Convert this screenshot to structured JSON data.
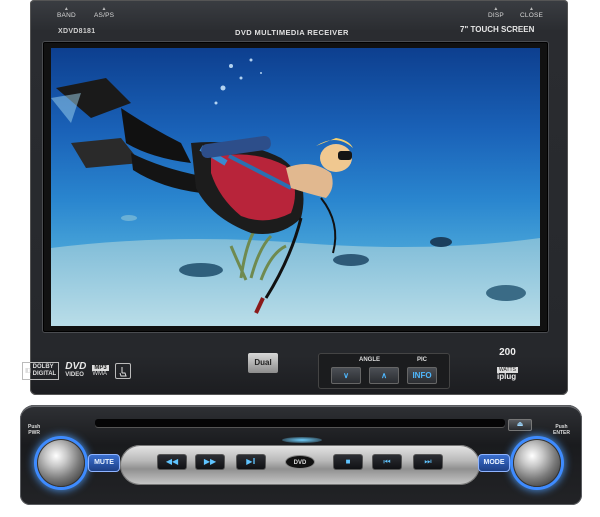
{
  "monitor": {
    "top_buttons": [
      {
        "label": "BAND"
      },
      {
        "label": "AS/PS"
      },
      {
        "label": "DISP"
      },
      {
        "label": "CLOSE"
      }
    ],
    "model": "XDVD8181",
    "subtitle": "DVD MULTIMEDIA RECEIVER",
    "screen_size": "7\"",
    "screen_size_label": "TOUCH SCREEN"
  },
  "logos": {
    "dolby_line1": "DOLBY",
    "dolby_line2": "DIGITAL",
    "dvd": "DVD",
    "dvd_sub": "VIDEO",
    "mp3": "MP3",
    "wma": "WMA"
  },
  "brand": "Dual",
  "controls": {
    "angle_label": "ANGLE",
    "pic_label": "PIC",
    "down_button": "∨",
    "up_button": "∧",
    "info_button": "INFO"
  },
  "power": {
    "value": "200",
    "unit": "WATTS"
  },
  "iplug": "iplug",
  "face": {
    "push_left_line1": "Push",
    "push_left_line2": "PWR",
    "push_right_line1": "Push",
    "push_right_line2": "ENTER",
    "mute_button": "MUTE",
    "mode_button": "MODE",
    "eject_button": "⏏",
    "center_badge": "DVD",
    "transport_buttons": [
      {
        "label": "◀◀"
      },
      {
        "label": "▶▶"
      },
      {
        "label": "▶‖"
      },
      {
        "label": "■"
      },
      {
        "label": "⏮"
      },
      {
        "label": "⏭"
      }
    ]
  },
  "colors": {
    "accent_blue": "#3e8bff",
    "button_text": "#5fc4ff",
    "body": "#26282c"
  }
}
